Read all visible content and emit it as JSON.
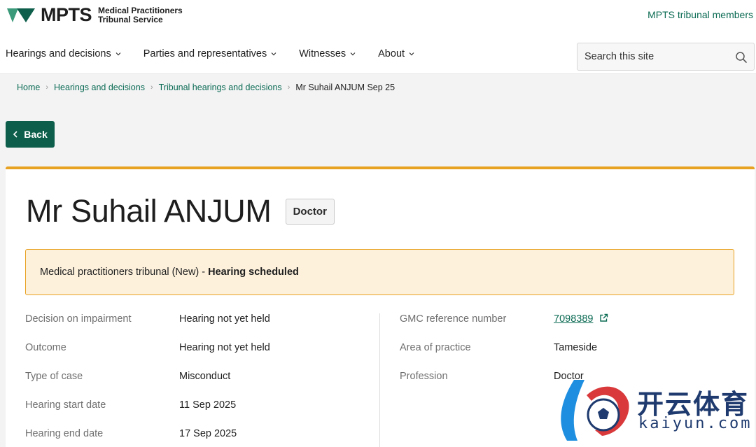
{
  "brand": {
    "short_name": "MPTS",
    "full_name_line1": "Medical Practitioners",
    "full_name_line2": "Tribunal Service",
    "members_link": "MPTS tribunal members"
  },
  "nav": {
    "items": [
      {
        "label": "Hearings and decisions"
      },
      {
        "label": "Parties and representatives"
      },
      {
        "label": "Witnesses"
      },
      {
        "label": "About"
      }
    ]
  },
  "search": {
    "placeholder": "Search this site"
  },
  "breadcrumb": {
    "items": [
      "Home",
      "Hearings and decisions",
      "Tribunal hearings and decisions"
    ],
    "current": "Mr Suhail ANJUM Sep 25"
  },
  "back_button": {
    "label": "Back"
  },
  "case": {
    "name": "Mr Suhail ANJUM",
    "role_badge": "Doctor",
    "status_prefix": "Medical practitioners tribunal (New) - ",
    "status_bold": "Hearing scheduled",
    "left_details": [
      {
        "label": "Decision on impairment",
        "value": "Hearing not yet held"
      },
      {
        "label": "Outcome",
        "value": "Hearing not yet held"
      },
      {
        "label": "Type of case",
        "value": "Misconduct"
      },
      {
        "label": "Hearing start date",
        "value": "11 Sep 2025"
      },
      {
        "label": "Hearing end date",
        "value": "17 Sep 2025"
      }
    ],
    "right_details": [
      {
        "label": "GMC reference number",
        "value": "7098389"
      },
      {
        "label": "Area of practice",
        "value": "Tameside"
      },
      {
        "label": "Profession",
        "value": "Doctor"
      }
    ]
  },
  "watermark": {
    "text": "开云体育",
    "sub": "kaiyun.com"
  },
  "colors": {
    "accent_green": "#0d5e4a",
    "link_green": "#0b6b53",
    "banner_orange": "#e8a222",
    "banner_bg": "#fdf1dc"
  }
}
